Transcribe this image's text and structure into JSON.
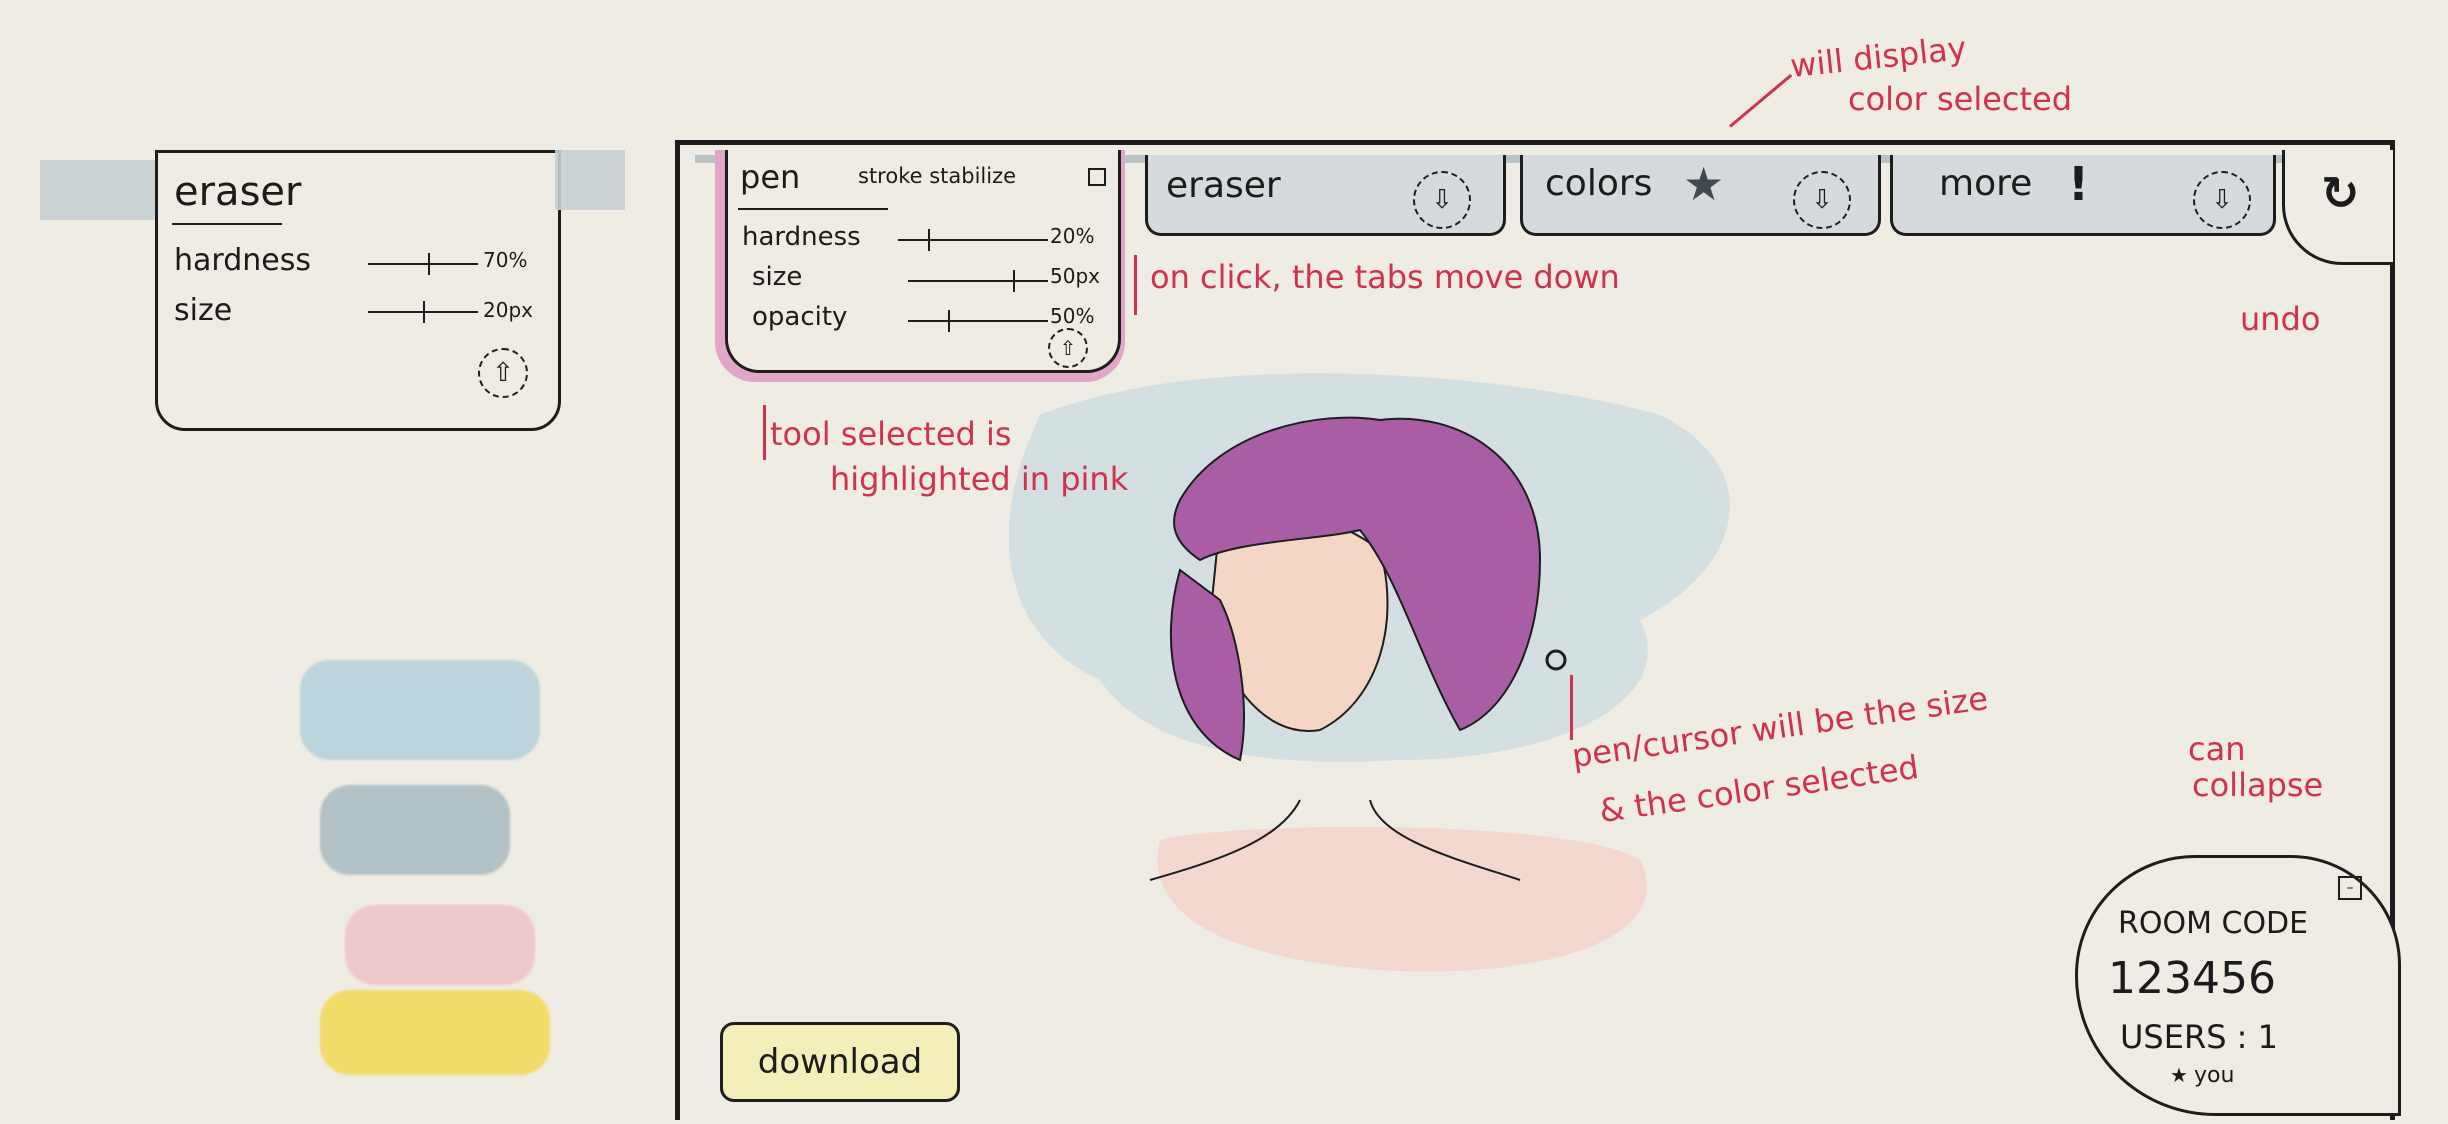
{
  "colors": {
    "paper": "#efece3",
    "ink": "#1d1d1d",
    "annotation": "#d0324d",
    "highlight": "#e2a6c9",
    "tab_fill": "#d7dadc",
    "hair": "#a85da4"
  },
  "eraser_panel": {
    "title": "eraser",
    "rows": [
      {
        "label": "hardness",
        "value": "70%",
        "level": 0.55
      },
      {
        "label": "size",
        "value": "20px",
        "level": 0.5
      }
    ],
    "collapse_icon": "arrow-up-icon"
  },
  "swatches": [
    {
      "name": "light-blue",
      "color": "#bcd5dc"
    },
    {
      "name": "gray-blue",
      "color": "#b3c2c6"
    },
    {
      "name": "pink",
      "color": "#f0c9cc"
    },
    {
      "name": "yellow",
      "color": "#f2dc6a"
    }
  ],
  "tabs": {
    "pen": {
      "label": "pen",
      "stabilizer_label": "stroke stabilize",
      "rows": [
        {
          "label": "hardness",
          "value": "20%",
          "level": 0.2
        },
        {
          "label": "size",
          "value": "50px",
          "level": 0.75
        },
        {
          "label": "opacity",
          "value": "50%",
          "level": 0.3
        }
      ],
      "collapse_icon": "arrow-up-icon"
    },
    "eraser": {
      "label": "eraser",
      "expand_icon": "arrow-down-icon"
    },
    "colors": {
      "label": "colors",
      "star_icon": "star-icon",
      "expand_icon": "arrow-down-icon"
    },
    "more": {
      "label": "more",
      "mark": "!",
      "expand_icon": "arrow-down-icon"
    },
    "undo_icon": "undo-icon"
  },
  "annotations": {
    "colors_display": [
      "will display",
      "color selected"
    ],
    "tabs_move": "on click, the tabs move down",
    "undo": "undo",
    "tool_selected": [
      "tool selected is",
      "highlighted in pink"
    ],
    "cursor": [
      "pen/cursor will be the size",
      "& the color selected"
    ],
    "collapse": [
      "can",
      "collapse"
    ]
  },
  "room": {
    "code_label": "ROOM CODE",
    "code": "123456",
    "users_label": "USERS : 1",
    "user_entry": "you"
  },
  "download_label": "download"
}
